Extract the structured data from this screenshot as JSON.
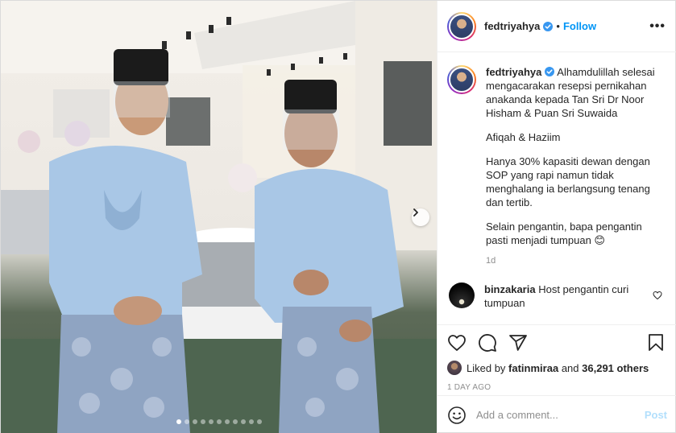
{
  "post": {
    "username": "fedtriyahya",
    "separator": "•",
    "follow_label": "Follow",
    "more_label": "•••",
    "caption": {
      "username": "fedtriyahya",
      "text_1": "Alhamdulillah selesai mengacarakan resepsi pernikahan anakanda kepada Tan Sri Dr Noor Hisham & Puan Sri Suwaida",
      "text_2": "Afiqah & Haziim",
      "text_3": "Hanya 30% kapasiti dewan dengan SOP yang rapi namun tidak menghalang ia berlangsung tenang dan tertib.",
      "text_4": "Selain pengantin, bapa pengantin pasti menjadi tumpuan 😊",
      "time": "1d"
    },
    "comments": [
      {
        "username": "binzakaria",
        "text": "Host pengantin curi tumpuan"
      }
    ],
    "likes": {
      "prefix": "Liked by ",
      "user": "fatinmiraa",
      "middle": " and ",
      "count": "36,291 others"
    },
    "time_ago": "1 DAY AGO",
    "comment_input": {
      "placeholder": "Add a comment..."
    },
    "post_label": "Post",
    "carousel": {
      "total": 11,
      "active_index": 0
    },
    "icons": {
      "verified": "verified-badge-icon",
      "like": "heart-icon",
      "comment": "comment-icon",
      "share": "share-icon",
      "save": "bookmark-icon",
      "emoji": "smiley-icon",
      "next": "chevron-right-icon"
    },
    "colors": {
      "link": "#0095f6",
      "post_disabled": "#b2dffc",
      "muted": "#8e8e8e",
      "verified": "#3897f0"
    }
  }
}
